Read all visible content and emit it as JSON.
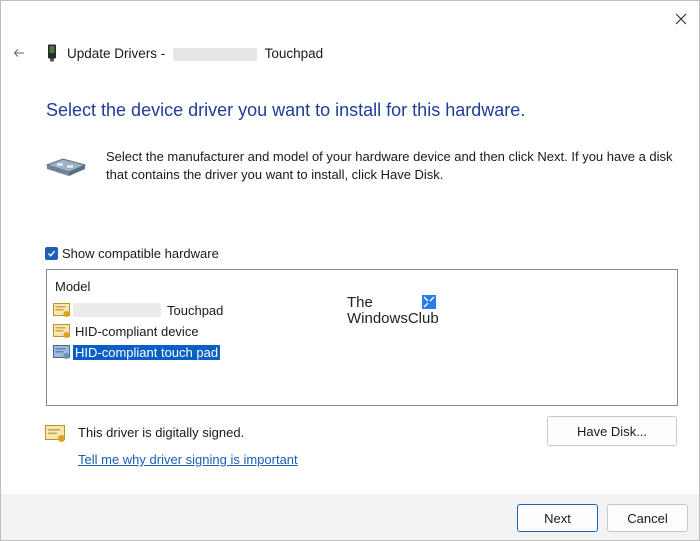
{
  "window": {
    "title_prefix": "Update Drivers -",
    "title_suffix": "Touchpad"
  },
  "header": {
    "heading": "Select the device driver you want to install for this hardware.",
    "description": "Select the manufacturer and model of your hardware device and then click Next. If you have a disk that contains the driver you want to install, click Have Disk."
  },
  "compatible": {
    "label": "Show compatible hardware",
    "checked": true
  },
  "model_list": {
    "header": "Model",
    "items": [
      {
        "label": "Touchpad",
        "selected": false
      },
      {
        "label": "HID-compliant device",
        "selected": false
      },
      {
        "label": "HID-compliant touch pad",
        "selected": true
      }
    ]
  },
  "watermark": {
    "line1": "The",
    "line2": "WindowsClub"
  },
  "signing": {
    "status": "This driver is digitally signed.",
    "link": "Tell me why driver signing is important"
  },
  "buttons": {
    "have_disk": "Have Disk...",
    "next": "Next",
    "cancel": "Cancel"
  },
  "colors": {
    "heading": "#1f3d99",
    "accent": "#0a5fc5",
    "link": "#1a5fb4"
  }
}
